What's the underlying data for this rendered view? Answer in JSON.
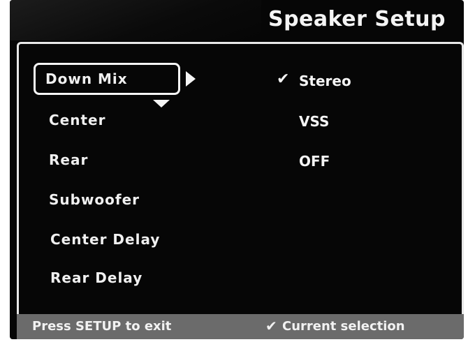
{
  "header": {
    "title": "Speaker Setup"
  },
  "menu": {
    "items": [
      {
        "label": "Down Mix"
      },
      {
        "label": "Center"
      },
      {
        "label": "Rear"
      },
      {
        "label": "Subwoofer"
      },
      {
        "label": "Center Delay"
      },
      {
        "label": "Rear Delay"
      }
    ]
  },
  "options": {
    "items": [
      {
        "label": "Stereo",
        "checked": true
      },
      {
        "label": "VSS",
        "checked": false
      },
      {
        "label": "OFF",
        "checked": false
      }
    ],
    "check_glyph": "✔"
  },
  "footer": {
    "exit_hint": "Press SETUP to exit",
    "current_selection_label": "Current selection",
    "check_glyph": "✔"
  },
  "colors": {
    "screen_bg": "#060606",
    "text": "#f4f4f4",
    "footer_bg": "#6b6b6b"
  },
  "icons": {
    "selection_arrow": "arrow-right-icon",
    "scroll_hint": "arrow-down-icon",
    "current_selection": "check-icon"
  }
}
